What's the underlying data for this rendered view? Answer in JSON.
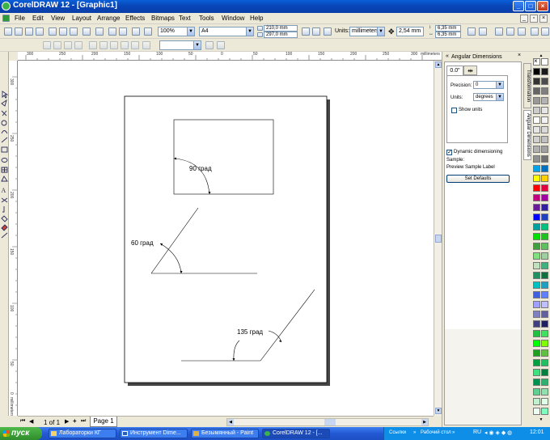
{
  "window": {
    "title": "CorelDRAW 12 - [Graphic1]",
    "minimize": "_",
    "maximize": "□",
    "close": "×"
  },
  "menu": [
    "File",
    "Edit",
    "View",
    "Layout",
    "Arrange",
    "Effects",
    "Bitmaps",
    "Text",
    "Tools",
    "Window",
    "Help"
  ],
  "toolbar": {
    "zoom": "100%",
    "paper": "A4",
    "width": "210,0 mm",
    "height": "297,0 mm",
    "units_label": "Units:",
    "units": "millimeters",
    "nudge": "2,54 mm",
    "dup_x": "6,35 mm",
    "dup_y": "6,35 mm"
  },
  "rulers": {
    "top": [
      "300",
      "250",
      "200",
      "150",
      "100",
      "50",
      "0",
      "50",
      "100",
      "150",
      "200",
      "250",
      "300",
      "millimeters"
    ],
    "left": [
      "300",
      "250",
      "200",
      "150",
      "100",
      "50",
      "0"
    ],
    "left_unit": "millimeters"
  },
  "drawing": {
    "label_90": "90 град",
    "label_60": "60 град",
    "label_135": "135 град"
  },
  "docker": {
    "title": "Angular Dimensions",
    "tab_value": "0.0\"",
    "precision_label": "Precision:",
    "precision_value": "0",
    "units_label": "Units:",
    "units_value": "degrees",
    "show_units": "Show units",
    "dynamic_dimensioning": "Dynamic dimensioning",
    "sample_label": "Sample:",
    "sample_text": "Preview Sample Label",
    "set_defaults": "Set Defaults",
    "vtab_transformation": "Transformation",
    "vtab_angular": "Angular Dimensions"
  },
  "pagebar": {
    "page_count": "1 of 1",
    "page_tab": "Page 1"
  },
  "taskbar": {
    "start": "пуск",
    "tasks": [
      "Лабораторки КГ",
      "Инструмент Dime...",
      "Безымянный - Paint",
      "CorelDRAW 12 - [..."
    ],
    "tray_links": "Ссылки",
    "tray_desktop": "Рабочий стол",
    "lang": "RU",
    "clock": "12:01"
  },
  "colors": {
    "titlebar": "#0a5fd8",
    "start": "#3a9a36",
    "taskbar": "#245edb"
  }
}
